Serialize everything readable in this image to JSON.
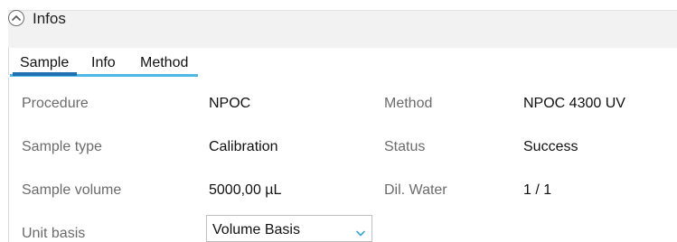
{
  "header": {
    "title": "Infos",
    "collapse_icon": "chevron-up-circle-icon"
  },
  "tabs": [
    {
      "label": "Sample",
      "active": true
    },
    {
      "label": "Info",
      "active": false
    },
    {
      "label": "Method",
      "active": false
    }
  ],
  "fields": {
    "procedure": {
      "label": "Procedure",
      "value": "NPOC"
    },
    "sample_type": {
      "label": "Sample type",
      "value": "Calibration"
    },
    "sample_volume": {
      "label": "Sample volume",
      "value": "5000,00 µL"
    },
    "unit_basis": {
      "label": "Unit basis",
      "value": "Volume Basis",
      "dropdown_icon": "chevron-down-icon"
    },
    "method": {
      "label": "Method",
      "value": "NPOC 4300 UV"
    },
    "status": {
      "label": "Status",
      "value": "Success"
    },
    "dil_water": {
      "label": "Dil. Water",
      "value": "1 / 1"
    }
  },
  "colors": {
    "accent": "#4db7e8",
    "active_tab": "#1f6fb3",
    "label": "#6b6b6b"
  }
}
